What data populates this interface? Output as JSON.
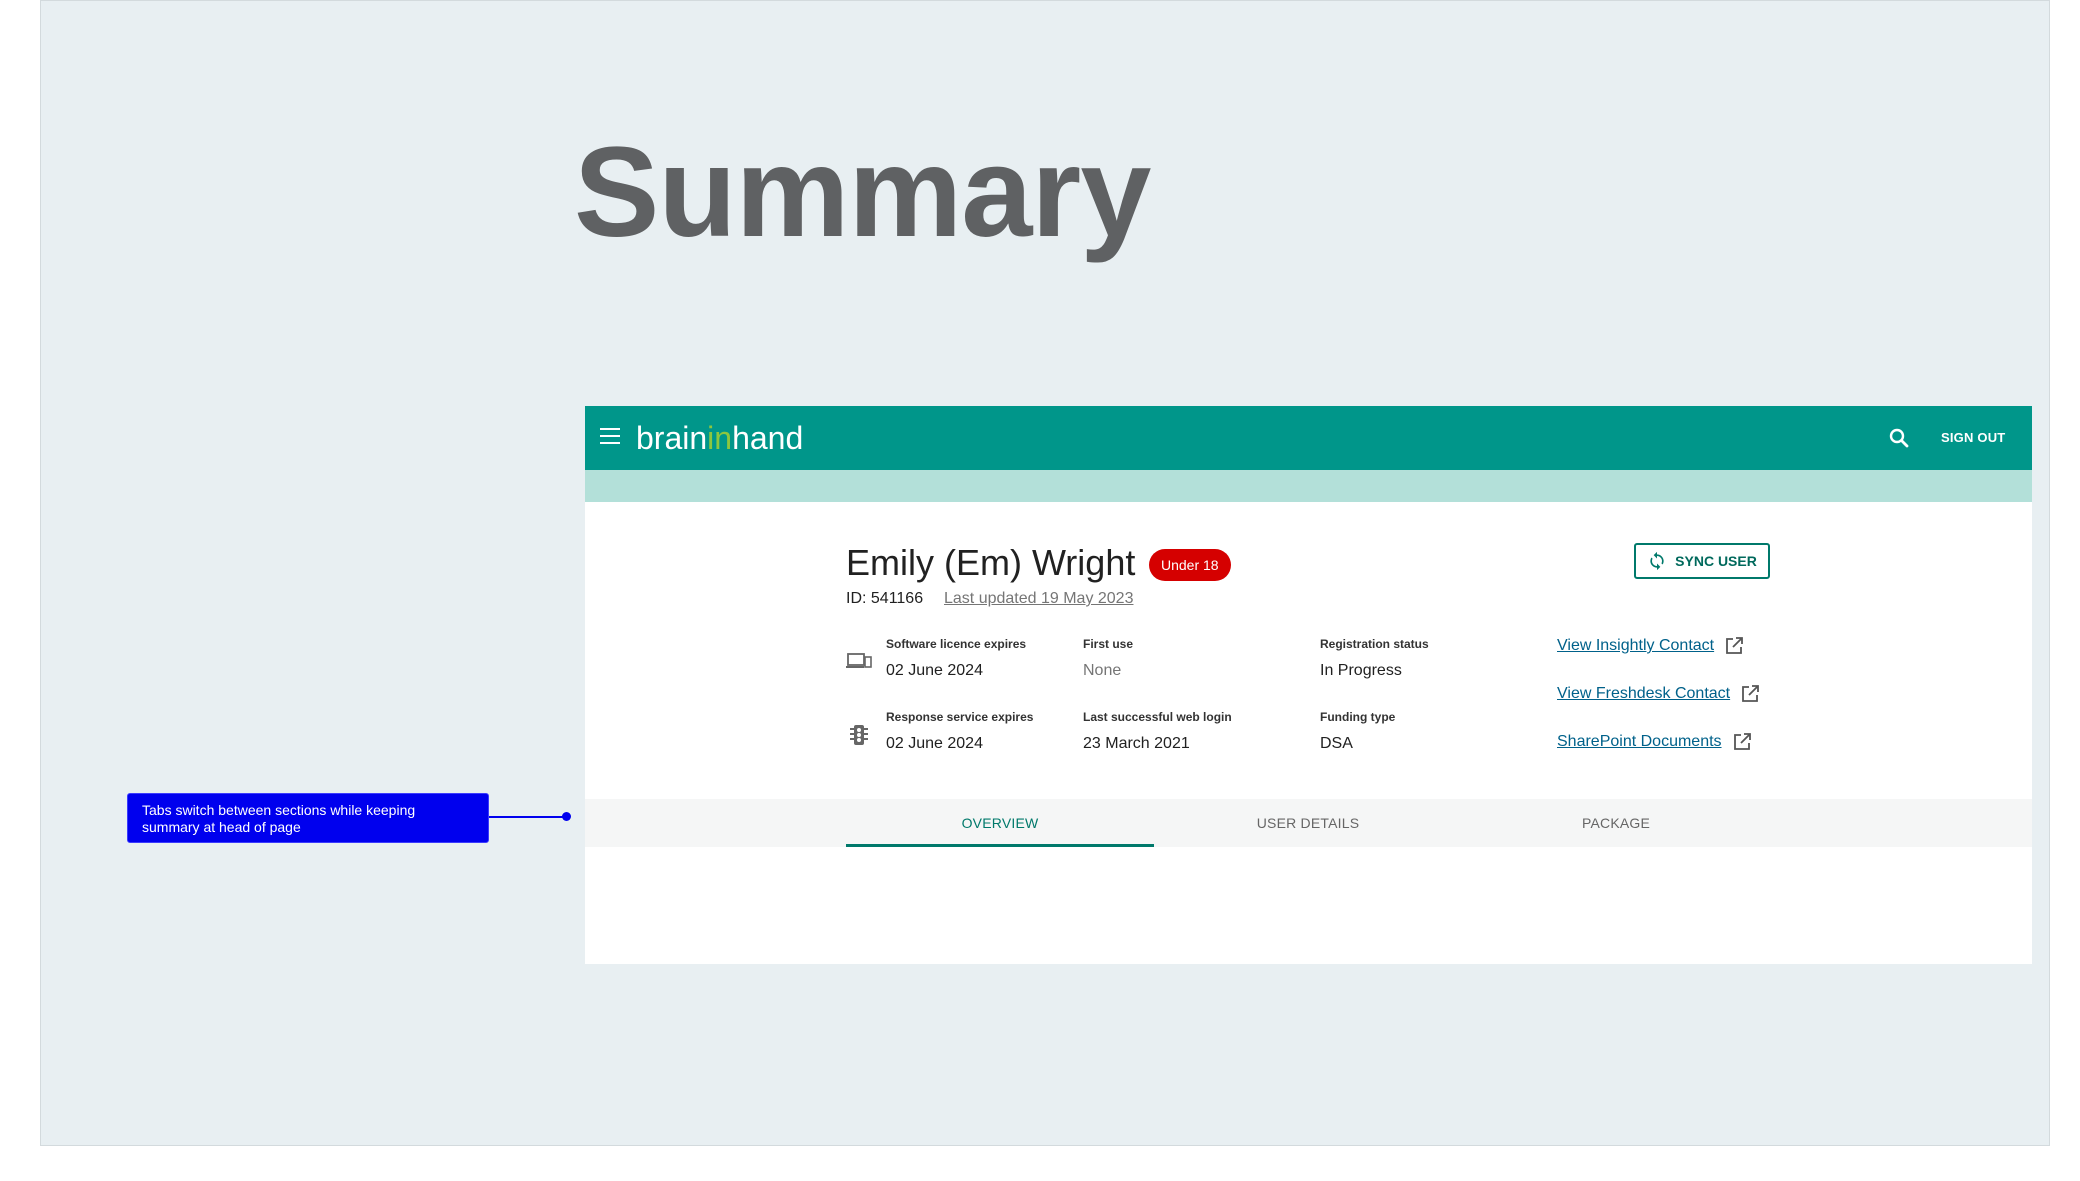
{
  "page": {
    "title": "Summary"
  },
  "header": {
    "logo_part1": "brain",
    "logo_part2": "in",
    "logo_part3": "hand",
    "sign_out_label": "SIGN OUT"
  },
  "user": {
    "name": "Emily (Em) Wright",
    "badge": "Under 18",
    "id_text": "ID: 541166",
    "last_updated": "Last updated 19 May 2023",
    "sync_label": "SYNC USER"
  },
  "fields": {
    "software_licence": {
      "label": "Software licence expires",
      "value": "02 June 2024"
    },
    "first_use": {
      "label": "First use",
      "value": "None"
    },
    "registration_status": {
      "label": "Registration status",
      "value": "In Progress"
    },
    "response_service": {
      "label": "Response service expires",
      "value": "02 June 2024"
    },
    "last_web_login": {
      "label": "Last successful web login",
      "value": "23 March 2021"
    },
    "funding_type": {
      "label": "Funding type",
      "value": "DSA"
    }
  },
  "links": [
    {
      "label": "View Insightly Contact"
    },
    {
      "label": "View Freshdesk Contact"
    },
    {
      "label": "SharePoint Documents"
    }
  ],
  "tabs": [
    {
      "label": "OVERVIEW",
      "active": true
    },
    {
      "label": "USER DETAILS",
      "active": false
    },
    {
      "label": "PACKAGE",
      "active": false
    }
  ],
  "annotation": {
    "text": "Tabs switch between sections while keeping summary at head of page"
  },
  "colors": {
    "appbar": "#00968a",
    "subbar": "#b3e0d9",
    "badge": "#d50000",
    "accent": "#00796b",
    "link": "#00618a",
    "callout": "#0000ee"
  },
  "icons": [
    "menu-icon",
    "search-icon",
    "sync-icon",
    "devices-icon",
    "traffic-light-icon",
    "external-link-icon"
  ]
}
